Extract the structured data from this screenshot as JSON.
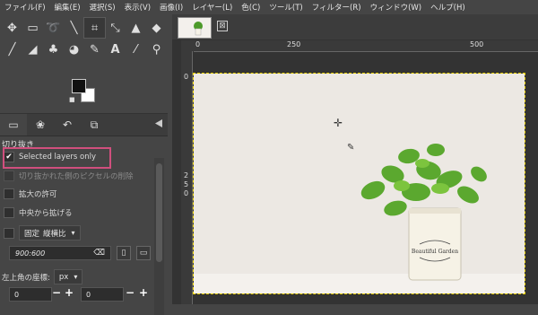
{
  "menu": [
    "ファイル(F)",
    "編集(E)",
    "選択(S)",
    "表示(V)",
    "画像(I)",
    "レイヤー(L)",
    "色(C)",
    "ツール(T)",
    "フィルター(R)",
    "ウィンドウ(W)",
    "ヘルプ(H)"
  ],
  "tool_options": {
    "title": "切り抜き",
    "selected_layers_only": "Selected layers only",
    "delete_pixels": "切り抜かれた側のピクセルの削除",
    "allow_growing": "拡大の許可",
    "expand_from_center": "中央から拡げる",
    "fixed_label": "固定",
    "fixed_mode": "縦横比",
    "ratio_value": "900:600",
    "position_label": "左上角の座標:",
    "unit": "px",
    "pos_x": "0",
    "pos_y": "0"
  },
  "ruler": {
    "h_labels": [
      "0",
      "250",
      "500"
    ],
    "v_labels": [
      "0",
      "2",
      "5",
      "0"
    ]
  },
  "canvas_product_text": "Beautiful Garden",
  "colors": {
    "accent_highlight": "#d04f7d",
    "selection": "#e8d000"
  }
}
